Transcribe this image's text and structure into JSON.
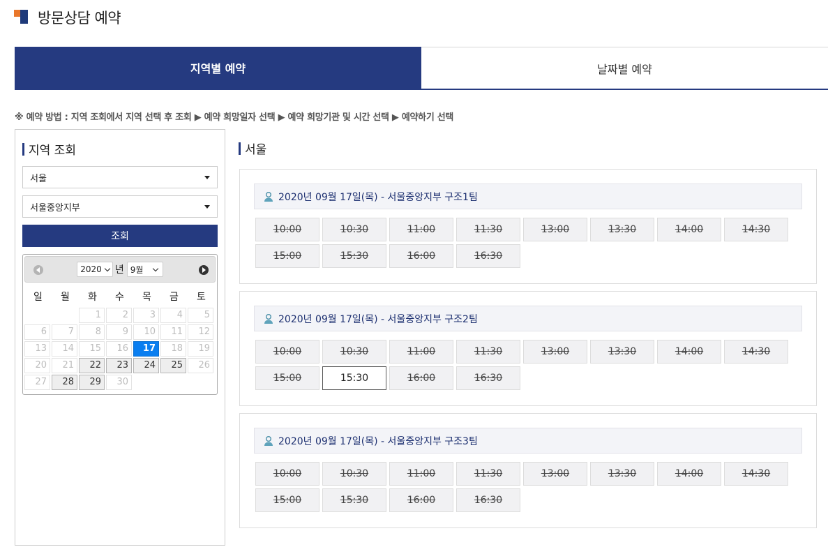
{
  "page": {
    "title": "방문상담 예약"
  },
  "tabs": [
    {
      "label": "지역별 예약",
      "active": true
    },
    {
      "label": "날짜별 예약",
      "active": false
    }
  ],
  "guide": "※ 예약 방법 : 지역 조회에서 지역 선택 후 조회 ▶ 예약 희망일자 선택 ▶ 예약 희망기관 및 시간 선택 ▶ 예약하기 선택",
  "search": {
    "title": "지역 조회",
    "region": "서울",
    "branch": "서울중앙지부",
    "button": "조회"
  },
  "calendar": {
    "year": "2020",
    "year_suffix": "년",
    "month": "9월",
    "weekdays": [
      "일",
      "월",
      "화",
      "수",
      "목",
      "금",
      "토"
    ],
    "selected_day": 17,
    "available_days": [
      22,
      23,
      24,
      25,
      28,
      29
    ],
    "weeks": [
      [
        null,
        null,
        1,
        2,
        3,
        4,
        5
      ],
      [
        6,
        7,
        8,
        9,
        10,
        11,
        12
      ],
      [
        13,
        14,
        15,
        16,
        17,
        18,
        19
      ],
      [
        20,
        21,
        22,
        23,
        24,
        25,
        26
      ],
      [
        27,
        28,
        29,
        30,
        null,
        null,
        null
      ]
    ]
  },
  "results": {
    "region_title": "서울",
    "teams": [
      {
        "title": "2020년 09월 17일(목) - 서울중앙지부 구조1팀",
        "slots": [
          {
            "time": "10:00",
            "available": false
          },
          {
            "time": "10:30",
            "available": false
          },
          {
            "time": "11:00",
            "available": false
          },
          {
            "time": "11:30",
            "available": false
          },
          {
            "time": "13:00",
            "available": false
          },
          {
            "time": "13:30",
            "available": false
          },
          {
            "time": "14:00",
            "available": false
          },
          {
            "time": "14:30",
            "available": false
          },
          {
            "time": "15:00",
            "available": false
          },
          {
            "time": "15:30",
            "available": false
          },
          {
            "time": "16:00",
            "available": false
          },
          {
            "time": "16:30",
            "available": false
          }
        ]
      },
      {
        "title": "2020년 09월 17일(목) - 서울중앙지부 구조2팀",
        "slots": [
          {
            "time": "10:00",
            "available": false
          },
          {
            "time": "10:30",
            "available": false
          },
          {
            "time": "11:00",
            "available": false
          },
          {
            "time": "11:30",
            "available": false
          },
          {
            "time": "13:00",
            "available": false
          },
          {
            "time": "13:30",
            "available": false
          },
          {
            "time": "14:00",
            "available": false
          },
          {
            "time": "14:30",
            "available": false
          },
          {
            "time": "15:00",
            "available": false
          },
          {
            "time": "15:30",
            "available": true
          },
          {
            "time": "16:00",
            "available": false
          },
          {
            "time": "16:30",
            "available": false
          }
        ]
      },
      {
        "title": "2020년 09월 17일(목) - 서울중앙지부 구조3팀",
        "slots": [
          {
            "time": "10:00",
            "available": false
          },
          {
            "time": "10:30",
            "available": false
          },
          {
            "time": "11:00",
            "available": false
          },
          {
            "time": "11:30",
            "available": false
          },
          {
            "time": "13:00",
            "available": false
          },
          {
            "time": "13:30",
            "available": false
          },
          {
            "time": "14:00",
            "available": false
          },
          {
            "time": "14:30",
            "available": false
          },
          {
            "time": "15:00",
            "available": false
          },
          {
            "time": "15:30",
            "available": false
          },
          {
            "time": "16:00",
            "available": false
          },
          {
            "time": "16:30",
            "available": false
          }
        ]
      }
    ]
  },
  "colors": {
    "primary": "#253a80",
    "accent_orange": "#e9772a",
    "selected_day": "#0a7ef0"
  },
  "icons": {
    "title_mark": "title-mark-icon",
    "team": "person-icon",
    "dropdown": "caret-down-icon",
    "prev": "prev-month-icon",
    "next": "next-month-icon"
  }
}
